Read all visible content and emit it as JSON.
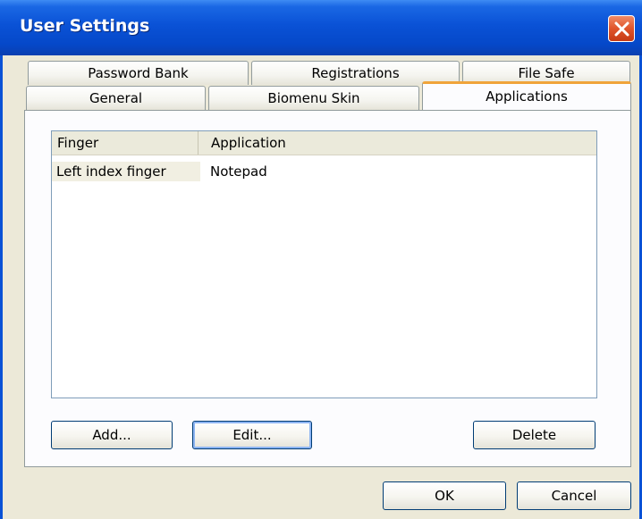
{
  "window": {
    "title": "User Settings"
  },
  "tabs": {
    "row_top": [
      "Password Bank",
      "Registrations",
      "File Safe"
    ],
    "row_bottom": [
      "General",
      "Biomenu Skin",
      "Applications"
    ],
    "active": "Applications"
  },
  "list": {
    "columns": [
      "Finger",
      "Application"
    ],
    "rows": [
      {
        "finger": "Left index finger",
        "application": "Notepad"
      }
    ]
  },
  "panel_buttons": {
    "add": "Add...",
    "edit": "Edit...",
    "delete": "Delete"
  },
  "dialog_buttons": {
    "ok": "OK",
    "cancel": "Cancel"
  },
  "colors": {
    "title_bar": "#0a52d6",
    "active_tab_accent": "#f0a43a",
    "dialog_bg": "#ece9d8"
  }
}
